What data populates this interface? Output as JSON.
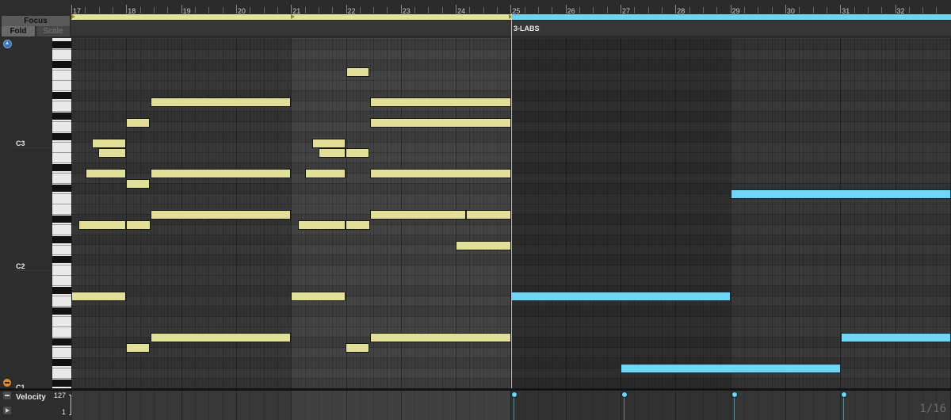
{
  "controls": {
    "focus": "Focus",
    "fold": "Fold",
    "scale": "Scale"
  },
  "octave_labels": [
    "C3",
    "C2",
    "C1"
  ],
  "ruler": {
    "bars": [
      "17",
      "18",
      "19",
      "20",
      "21",
      "22",
      "23",
      "24",
      "25",
      "26",
      "27",
      "28",
      "29",
      "30",
      "31",
      "32"
    ]
  },
  "clip": {
    "name": "3-LABS"
  },
  "velocity": {
    "label": "Velocity",
    "max": "127",
    "min": "1"
  },
  "grid_resolution": "1/16",
  "colors": {
    "note_yellow": "#e2df98",
    "note_blue": "#6fd6f3",
    "loop_yellow": "#e2e396",
    "loop_blue": "#6fd4f2",
    "icon_blue": "#3b6fb8",
    "icon_orange": "#e08a2a"
  },
  "icons": [
    "preview-icon",
    "scroll-to-notes-icon",
    "velocity-icon",
    "expand-lane-icon"
  ]
}
